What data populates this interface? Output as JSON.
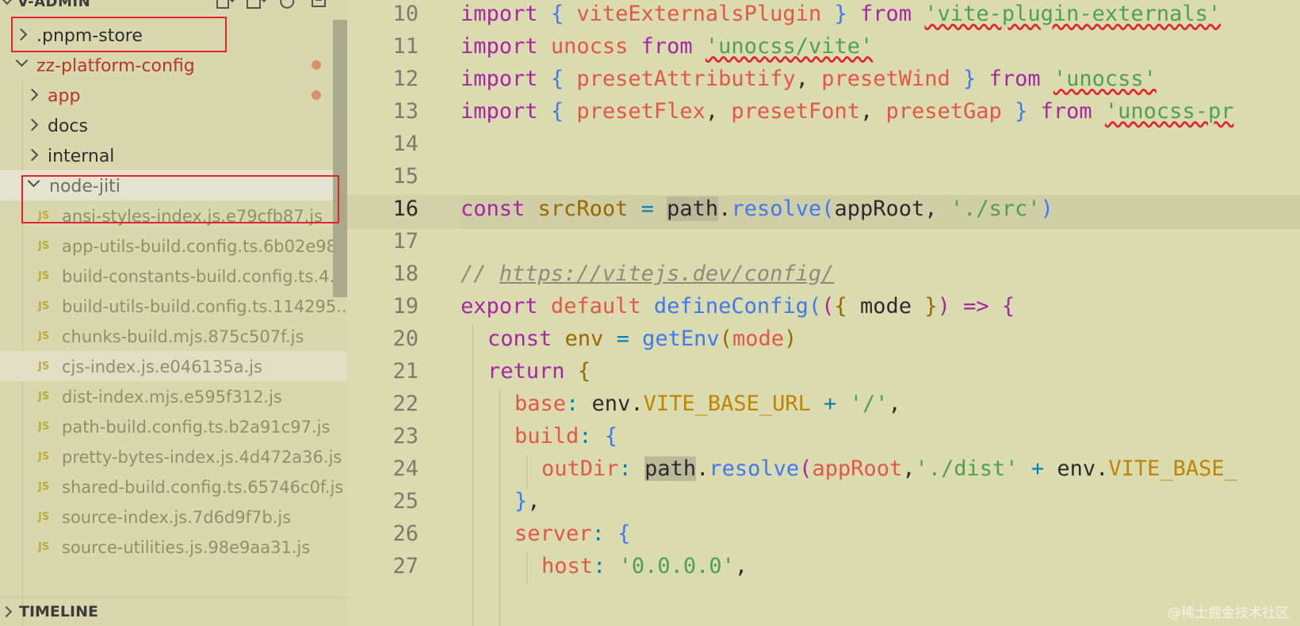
{
  "explorer": {
    "title": "V-ADMIN",
    "actions": [
      "new-file-icon",
      "new-folder-icon",
      "refresh-icon",
      "collapse-all-icon"
    ],
    "folders": [
      {
        "label": ".pnpm-store",
        "state": "closed"
      },
      {
        "label": "zz-platform-config",
        "state": "open",
        "color": "#c0392b"
      },
      {
        "label": "app",
        "state": "closed",
        "color": "#c0392b"
      },
      {
        "label": "docs",
        "state": "closed"
      },
      {
        "label": "internal",
        "state": "closed"
      },
      {
        "label": "node-jiti",
        "state": "open"
      }
    ],
    "files": [
      "ansi-styles-index.js.e79cfb87.js",
      "app-utils-build.config.ts.6b02e98...",
      "build-constants-build.config.ts.4...",
      "build-utils-build.config.ts.114295...",
      "chunks-build.mjs.875c507f.js",
      "cjs-index.js.e046135a.js",
      "dist-index.mjs.e595f312.js",
      "path-build.config.ts.b2a91c97.js",
      "pretty-bytes-index.js.4d472a36.js",
      "shared-build.config.ts.65746c0f.js",
      "source-index.js.7d6d9f7b.js",
      "source-utilities.js.98e9aa31.js"
    ],
    "file_badge": "JS",
    "timeline": "TIMELINE"
  },
  "editor": {
    "line_numbers": [
      "10",
      "11",
      "12",
      "13",
      "14",
      "15",
      "16",
      "17",
      "18",
      "19",
      "20",
      "21",
      "22",
      "23",
      "24",
      "25",
      "26",
      "27"
    ],
    "active_line": "16",
    "lines": {
      "l10": [
        "import",
        " ",
        "{",
        " ",
        "viteExternalsPlugin",
        " ",
        "}",
        " ",
        "from",
        " ",
        "'vite-plugin-externals'"
      ],
      "l11": [
        "import",
        " ",
        "unocss",
        " ",
        "from",
        " ",
        "'unocss/vite'"
      ],
      "l12": [
        "import",
        " ",
        "{",
        " ",
        "presetAttributify",
        ", ",
        "presetWind",
        " ",
        "}",
        " ",
        "from",
        " ",
        "'unocss'"
      ],
      "l13": [
        "import",
        " ",
        "{",
        " ",
        "presetFlex",
        ", ",
        "presetFont",
        ", ",
        "presetGap",
        " ",
        "}",
        " ",
        "from",
        " ",
        "'unocss-pr"
      ],
      "l16": [
        "const",
        " ",
        "srcRoot",
        " ",
        "=",
        " ",
        "path",
        ".",
        "resolve",
        "(",
        "appRoot",
        ", ",
        "'./src'",
        ")"
      ],
      "l18": [
        "// ",
        "https://vitejs.dev/config/"
      ],
      "l19": [
        "export",
        " ",
        "default",
        " ",
        "defineConfig",
        "(",
        "(",
        "{",
        " mode ",
        "}",
        ")",
        " ",
        "=>",
        " ",
        "{"
      ],
      "l20": [
        "const",
        " ",
        "env",
        " ",
        "=",
        " ",
        "getEnv",
        "(",
        "mode",
        ")"
      ],
      "l21": [
        "return",
        " ",
        "{"
      ],
      "l22": [
        "base",
        ":",
        " env.",
        "VITE_BASE_URL",
        " ",
        "+",
        " ",
        "'/'",
        ","
      ],
      "l23": [
        "build",
        ":",
        " ",
        "{"
      ],
      "l24": [
        "outDir",
        ":",
        " ",
        "path",
        ".",
        "resolve",
        "(",
        "appRoot",
        ",",
        "'./dist'",
        " ",
        "+",
        " env.",
        "VITE_BASE_"
      ],
      "l25": [
        "}",
        ","
      ],
      "l26": [
        "server",
        ":",
        " ",
        "{"
      ],
      "l27": [
        "host",
        ":",
        " ",
        "'0.0.0.0'",
        ","
      ]
    }
  },
  "watermark": "@稀土掘金技术社区"
}
